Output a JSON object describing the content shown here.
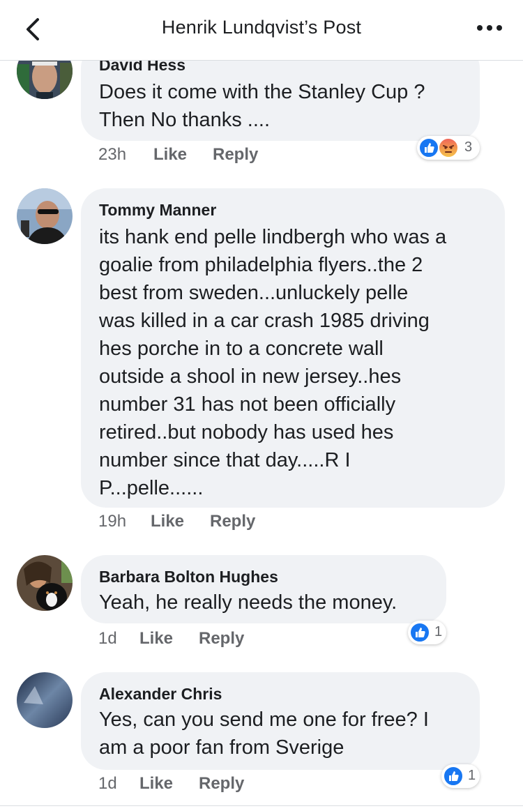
{
  "header": {
    "title": "Henrik Lundqvist’s Post"
  },
  "comments": [
    {
      "author": "David Hess",
      "lines": [
        "Does it come with the Stanley Cup ?",
        "Then No thanks ...."
      ],
      "time": "23h",
      "like_label": "Like",
      "reply_label": "Reply",
      "reactions": [
        "like-icon",
        "angry-icon"
      ],
      "reaction_count": "3"
    },
    {
      "author": "Tommy Manner",
      "lines": [
        "its hank end pelle lindbergh who was a",
        "goalie from philadelphia flyers..the 2",
        "best from sweden...unluckely pelle",
        "was killed in a car crash 1985 driving",
        "hes porche in to a concrete wall",
        "outside a shool in new jersey..hes",
        "number 31 has not been officially",
        "retired..but nobody has used hes",
        "number since that day.....R I",
        "P...pelle......"
      ],
      "time": "19h",
      "like_label": "Like",
      "reply_label": "Reply"
    },
    {
      "author": "Barbara Bolton Hughes",
      "lines": [
        "Yeah, he really needs the money."
      ],
      "time": "1d",
      "like_label": "Like",
      "reply_label": "Reply",
      "reactions": [
        "like-icon"
      ],
      "reaction_count": "1"
    },
    {
      "author": "Alexander Chris",
      "lines": [
        "Yes, can you send me one for free? I",
        "am a poor fan from Sverige"
      ],
      "time": "1d",
      "like_label": "Like",
      "reply_label": "Reply",
      "reactions": [
        "like-icon"
      ],
      "reaction_count": "1"
    }
  ],
  "colors": {
    "bubble_bg": "#f0f2f5",
    "like_blue": "#1877f2",
    "meta_gray": "#65676b",
    "text": "#1c1e21"
  }
}
